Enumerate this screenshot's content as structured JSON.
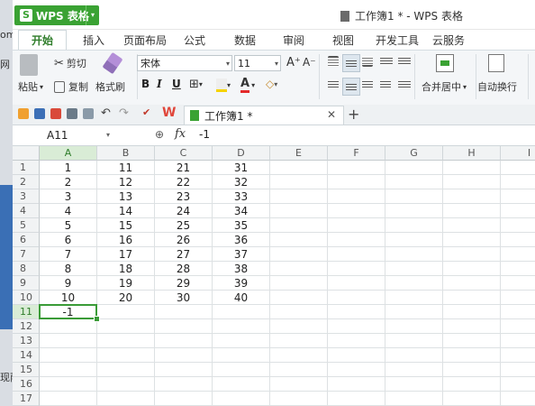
{
  "background": {
    "frag1": "om",
    "frag2": "网",
    "frag3": "现雨"
  },
  "app": {
    "logo": "S",
    "name": "WPS 表格",
    "dropdown": "▾"
  },
  "window_title": "工作簿1 * - WPS 表格",
  "ribbon_tabs": [
    "开始",
    "插入",
    "页面布局",
    "公式",
    "数据",
    "审阅",
    "视图",
    "开发工具",
    "云服务"
  ],
  "ribbon": {
    "paste": "粘贴",
    "paste_arrow": "▾",
    "cut": "剪切",
    "copy": "复制",
    "format_painter": "格式刷",
    "font_name": "宋体",
    "font_size": "11",
    "bold": "B",
    "italic": "I",
    "underline": "U",
    "merge_center": "合并居中",
    "wrap_text": "自动换行",
    "grow_font": "A⁺",
    "shrink_font": "A⁻",
    "font_color": "A",
    "clear": "◇"
  },
  "doc_tab": {
    "label": "工作簿1 *",
    "close": "✕",
    "new": "+"
  },
  "formula_bar": {
    "cell_ref": "A11",
    "fx": "fx",
    "value": "-1",
    "zoom_symbol": "⊕"
  },
  "columns": [
    "A",
    "B",
    "C",
    "D",
    "E",
    "F",
    "G",
    "H",
    "I"
  ],
  "rows": [
    "1",
    "2",
    "3",
    "4",
    "5",
    "6",
    "7",
    "8",
    "9",
    "10",
    "11",
    "12",
    "13",
    "14",
    "15",
    "16",
    "17"
  ],
  "cells": [
    [
      "1",
      "11",
      "21",
      "31"
    ],
    [
      "2",
      "12",
      "22",
      "32"
    ],
    [
      "3",
      "13",
      "23",
      "33"
    ],
    [
      "4",
      "14",
      "24",
      "34"
    ],
    [
      "5",
      "15",
      "25",
      "35"
    ],
    [
      "6",
      "16",
      "26",
      "36"
    ],
    [
      "7",
      "17",
      "27",
      "37"
    ],
    [
      "8",
      "18",
      "28",
      "38"
    ],
    [
      "9",
      "19",
      "29",
      "39"
    ],
    [
      "10",
      "20",
      "30",
      "40"
    ],
    [
      "-1",
      "",
      "",
      ""
    ]
  ],
  "selected": {
    "col": "A",
    "row": "11"
  },
  "colors": {
    "accent": "#3aa233",
    "selection": "#3a9b37",
    "header_selected": "#d9ecd6"
  }
}
